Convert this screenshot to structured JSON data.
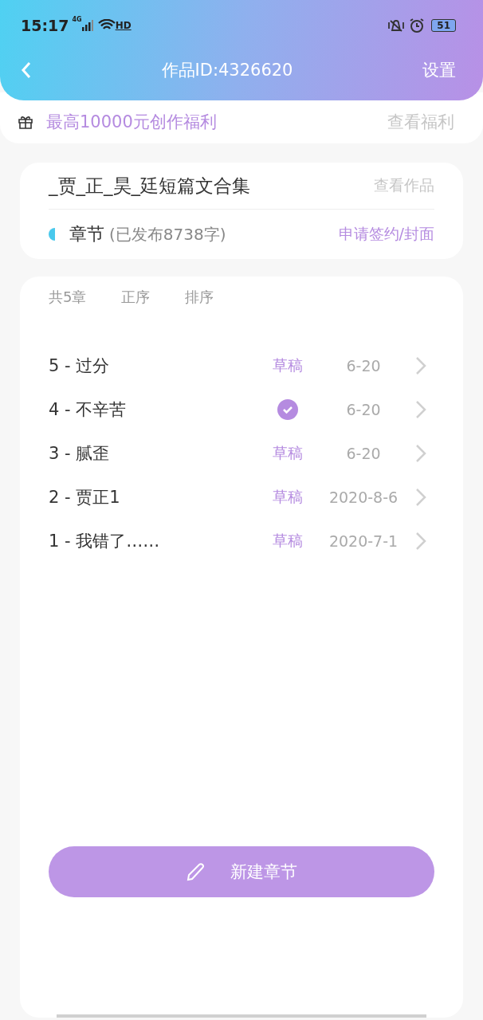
{
  "status_bar": {
    "time": "15:17",
    "network": "4G",
    "hd": "HD",
    "battery": "51"
  },
  "nav": {
    "title": "作品ID:4326620",
    "action": "设置"
  },
  "promo": {
    "text": "最高10000元创作福利",
    "link": "查看福利"
  },
  "work": {
    "title": "_贾_正_昊_廷短篇文合集",
    "link": "查看作品",
    "section": "章节",
    "section_note": "(已发布8738字)",
    "apply": "申请签约/封面"
  },
  "chapters": {
    "count": "共5章",
    "sort_options": [
      "正序",
      "排序"
    ],
    "rows": [
      {
        "title": "5 - 过分",
        "kind": "draft",
        "status": "草稿",
        "date": "6-20"
      },
      {
        "title": "4 - 不辛苦",
        "kind": "published",
        "date": "6-20"
      },
      {
        "title": "3 - 腻歪",
        "kind": "draft",
        "status": "草稿",
        "date": "6-20"
      },
      {
        "title": "2 - 贾正1",
        "kind": "draft",
        "status": "草稿",
        "date": "2020-8-6"
      },
      {
        "title": "1 - 我错了……",
        "kind": "draft",
        "status": "草稿",
        "date": "2020-7-1"
      }
    ]
  },
  "new_chapter_button": "新建章节"
}
